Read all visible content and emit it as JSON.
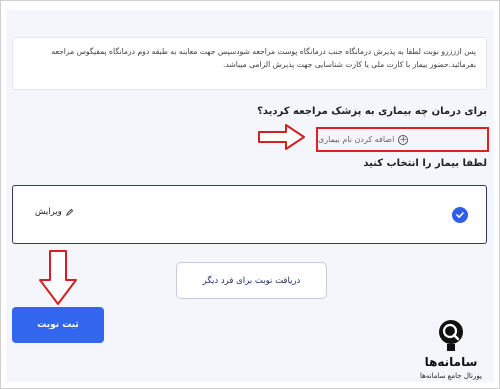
{
  "info": {
    "text": "پس ازززرو نوبت لطفا به پذیرش درمانگاه جنب درمانگاه پوست مراجعه شودسپس جهت معاینه به طبقه دوم درمانگاه پمفیگوس مراجعه بفرمائید.حضور بیمار با کارت ملی یا کارت شناسایی جهت پذیرش الزامی میباشد."
  },
  "form": {
    "question": "برای درمان چه بیماری به پزشک مراجعه کردید؟",
    "add_name_label": "اضافه کردن نام بیماری",
    "select_patient_label": "لطفا بیمار را انتخاب کنید",
    "edit_label": "ویرایش",
    "another_person_label": "دریافت نوبت برای فرد دیگر",
    "submit_label": "ثبت نوبت"
  },
  "logo": {
    "title": "سامانه‌ها",
    "subtitle": "پورتال جامع سامانه‌ها"
  },
  "icons": {
    "add": "plus-circle-icon",
    "check": "check-circle-icon",
    "edit": "pencil-icon",
    "arrow_right": "red-arrow-right-icon",
    "arrow_down": "red-arrow-down-icon"
  },
  "colors": {
    "primary": "#3366ee",
    "highlight": "#e02020",
    "card_border": "#2d3c6b"
  }
}
